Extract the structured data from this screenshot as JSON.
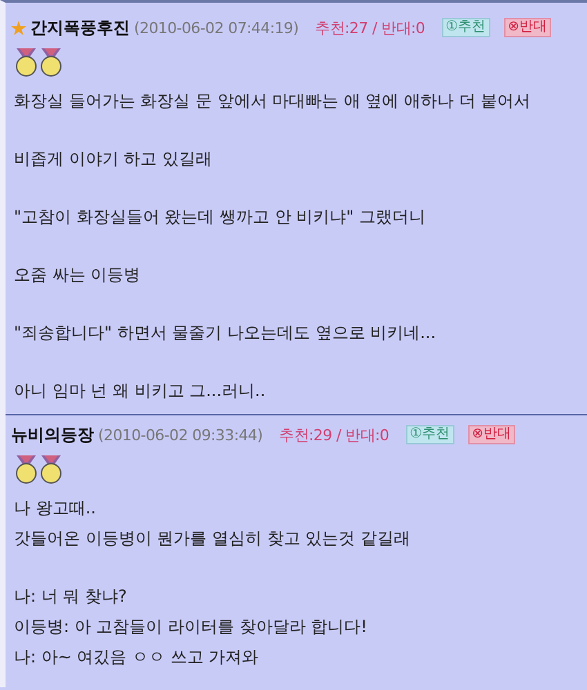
{
  "comments": [
    {
      "featured": true,
      "author": "간지폭풍후진",
      "date": "(2010-06-02 07:44:19)",
      "votes": "추천:27 / 반대:0",
      "recommend_button": "①추천",
      "oppose_button": "⊗반대",
      "paragraphs": [
        [
          "화장실 들어가는 화장실 문 앞에서 마대빠는 애 옆에 애하나 더 붙어서"
        ],
        [
          "비좁게 이야기 하고 있길래"
        ],
        [
          "\"고참이 화장실들어 왔는데 쌩까고 안 비키냐\" 그랬더니"
        ],
        [
          "오줌 싸는 이등병"
        ],
        [
          "\"죄송합니다\" 하면서 물줄기 나오는데도 옆으로 비키네..."
        ],
        [
          "아니 임마 넌 왜 비키고 그...러니.."
        ]
      ]
    },
    {
      "featured": false,
      "author": "뉴비의등장",
      "date": "(2010-06-02 09:33:44)",
      "votes": "추천:29 / 반대:0",
      "recommend_button": "①추천",
      "oppose_button": "⊗반대",
      "paragraphs": [
        [
          "나 왕고때..",
          "갓들어온 이등병이 뭔가를 열심히 찾고 있는것 같길래"
        ],
        [
          "나: 너 뭐 찾냐?",
          "이등병: 아 고참들이 라이터를 찾아달라 합니다!",
          "나: 아~ 여깄음 ㅇㅇ 쓰고 가져와"
        ]
      ]
    }
  ]
}
